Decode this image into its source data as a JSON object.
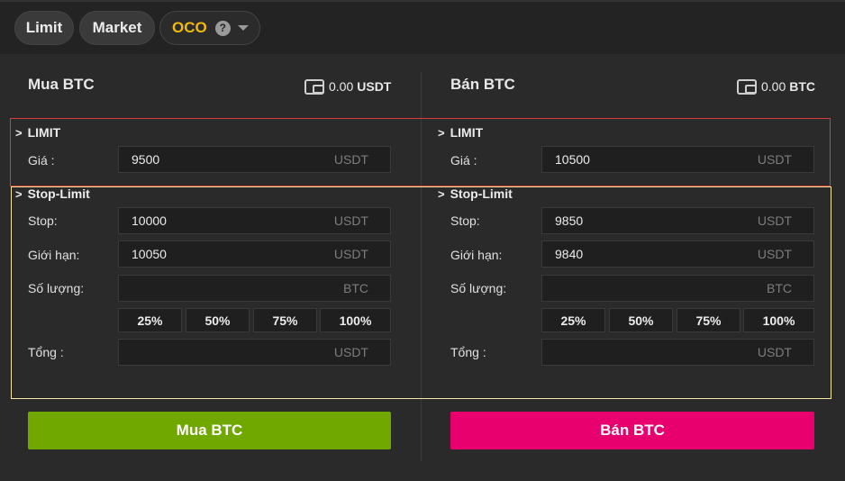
{
  "order_tabs": {
    "limit": "Limit",
    "market": "Market",
    "oco": "OCO",
    "help_glyph": "?"
  },
  "buy": {
    "title": "Mua BTC",
    "balance_value": "0.00",
    "balance_unit": "USDT",
    "limit_section": "LIMIT",
    "price_label": "Giá :",
    "price_value": "9500",
    "price_unit": "USDT",
    "stop_limit_section": "Stop-Limit",
    "stop_label": "Stop:",
    "stop_value": "10000",
    "stop_unit": "USDT",
    "limit_label": "Giới hạn:",
    "limit_value": "10050",
    "limit_unit": "USDT",
    "amount_label": "Số lượng:",
    "amount_value": "",
    "amount_unit": "BTC",
    "percents": [
      "25%",
      "50%",
      "75%",
      "100%"
    ],
    "total_label": "Tổng :",
    "total_value": "",
    "total_unit": "USDT",
    "button": "Mua BTC"
  },
  "sell": {
    "title": "Bán BTC",
    "balance_value": "0.00",
    "balance_unit": "BTC",
    "limit_section": "LIMIT",
    "price_label": "Giá :",
    "price_value": "10500",
    "price_unit": "USDT",
    "stop_limit_section": "Stop-Limit",
    "stop_label": "Stop:",
    "stop_value": "9850",
    "stop_unit": "USDT",
    "limit_label": "Giới hạn:",
    "limit_value": "9840",
    "limit_unit": "USDT",
    "amount_label": "Số lượng:",
    "amount_value": "",
    "amount_unit": "BTC",
    "percents": [
      "25%",
      "50%",
      "75%",
      "100%"
    ],
    "total_label": "Tổng :",
    "total_value": "",
    "total_unit": "USDT",
    "button": "Bán BTC"
  },
  "colors": {
    "oco_accent": "#f0b90b",
    "buy_button": "#70a800",
    "sell_button": "#e8006f",
    "limit_highlight": "#d43c3c",
    "stop_limit_highlight": "#f5e6a0"
  }
}
